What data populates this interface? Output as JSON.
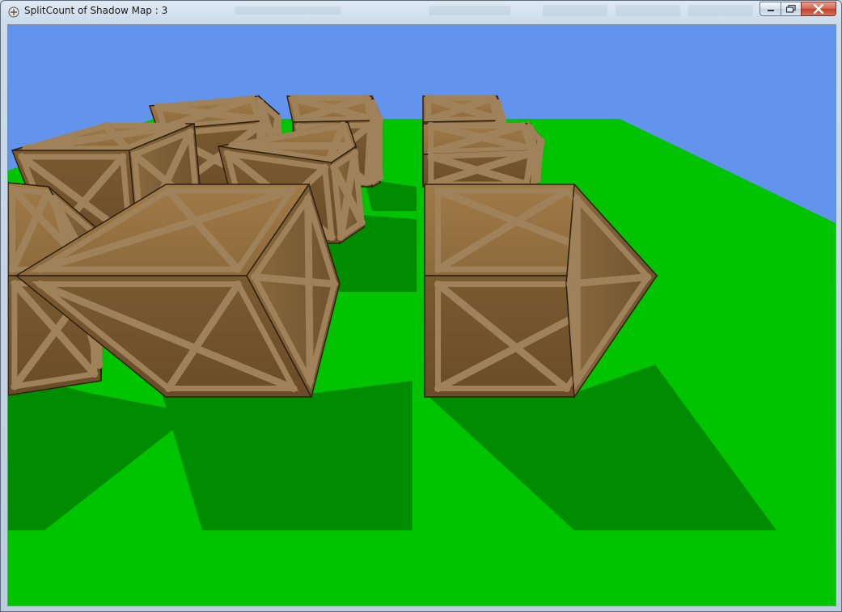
{
  "window": {
    "title": "SplitCount of Shadow Map : 3",
    "icon": "app-icon",
    "buttons": {
      "minimize": "minimize-icon",
      "maximize": "maximize-icon",
      "close": "close-icon"
    }
  },
  "scene": {
    "sky_color": "#6394ed",
    "ground_color": "#00c400",
    "shadow_color": "#008c00",
    "crate_color": "#8a6a3c",
    "crate_strap_color": "#a0825a",
    "object": "wooden-crate"
  }
}
